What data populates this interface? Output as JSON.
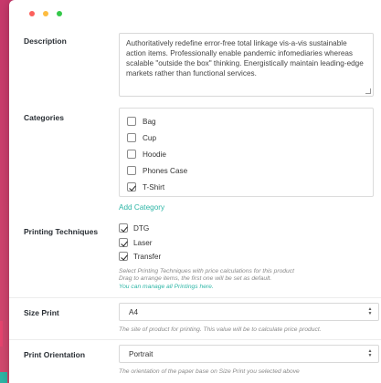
{
  "window": {
    "controls": [
      "close",
      "minimize",
      "maximize"
    ]
  },
  "description": {
    "label": "Description",
    "value": "Authoritatively redefine error-free total linkage vis-a-vis sustainable action items. Professionally enable pandemic infomediaries whereas scalable \"outside the box\" thinking. Energistically maintain leading-edge markets rather than functional services."
  },
  "categories": {
    "label": "Categories",
    "items": [
      {
        "label": "Bag",
        "checked": false
      },
      {
        "label": "Cup",
        "checked": false
      },
      {
        "label": "Hoodie",
        "checked": false
      },
      {
        "label": "Phones Case",
        "checked": false
      },
      {
        "label": "T-Shirt",
        "checked": true
      }
    ],
    "add_label": "Add Category"
  },
  "printing_techniques": {
    "label": "Printing Techniques",
    "items": [
      {
        "label": "DTG",
        "checked": true
      },
      {
        "label": "Laser",
        "checked": true
      },
      {
        "label": "Transfer",
        "checked": true
      }
    ],
    "help_line1": "Select Printing Techniques with price calculations for this product",
    "help_line2": "Drag to arrange items, the first one will be set as default.",
    "manage_link": "You can manage all Printings here."
  },
  "size_print": {
    "label": "Size Print",
    "value": "A4",
    "help": "The site of product for printing. This value will be to calculate price product."
  },
  "print_orientation": {
    "label": "Print Orientation",
    "value": "Portrait",
    "help": "The orientation of the paper base on Size Print you selected above"
  },
  "colors": {
    "accent": "#2eb6a6",
    "background": "#d2476f"
  }
}
